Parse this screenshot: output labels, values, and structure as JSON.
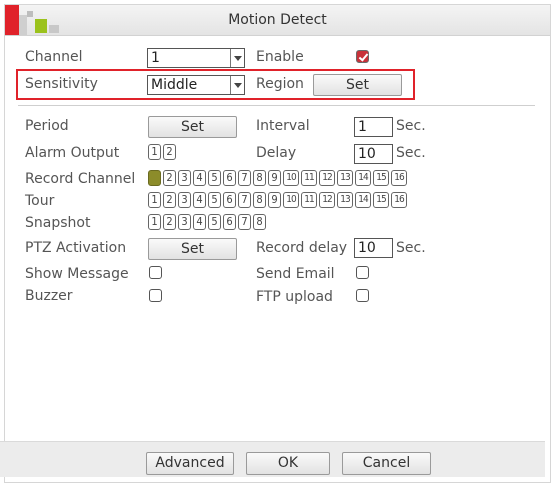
{
  "dialog": {
    "title": "Motion Detect"
  },
  "channel": {
    "label": "Channel",
    "value": "1"
  },
  "enable": {
    "label": "Enable",
    "checked": true
  },
  "sensitivity": {
    "label": "Sensitivity",
    "value": "Middle"
  },
  "region": {
    "label": "Region",
    "button": "Set"
  },
  "period": {
    "label": "Period",
    "button": "Set"
  },
  "interval": {
    "label": "Interval",
    "value": "1",
    "unit": "Sec."
  },
  "alarm_output": {
    "label": "Alarm Output",
    "options": [
      "1",
      "2"
    ]
  },
  "delay": {
    "label": "Delay",
    "value": "10",
    "unit": "Sec."
  },
  "record_channel": {
    "label": "Record Channel",
    "options": [
      "1",
      "2",
      "3",
      "4",
      "5",
      "6",
      "7",
      "8",
      "9",
      "10",
      "11",
      "12",
      "13",
      "14",
      "15",
      "16"
    ],
    "selected": [
      "1"
    ]
  },
  "tour": {
    "label": "Tour",
    "options": [
      "1",
      "2",
      "3",
      "4",
      "5",
      "6",
      "7",
      "8",
      "9",
      "10",
      "11",
      "12",
      "13",
      "14",
      "15",
      "16"
    ]
  },
  "snapshot": {
    "label": "Snapshot",
    "options": [
      "1",
      "2",
      "3",
      "4",
      "5",
      "6",
      "7",
      "8"
    ]
  },
  "ptz_activation": {
    "label": "PTZ Activation",
    "button": "Set"
  },
  "record_delay": {
    "label": "Record delay",
    "value": "10",
    "unit": "Sec."
  },
  "show_message": {
    "label": "Show Message",
    "checked": false
  },
  "send_email": {
    "label": "Send Email",
    "checked": false
  },
  "buzzer": {
    "label": "Buzzer",
    "checked": false
  },
  "ftp_upload": {
    "label": "FTP upload",
    "checked": false
  },
  "footer": {
    "advanced": "Advanced",
    "ok": "OK",
    "cancel": "Cancel"
  },
  "colors": {
    "highlight_border": "#e0222a",
    "checkbox_checked": "#c8323a",
    "selected_channel": "#8c8c2a"
  }
}
